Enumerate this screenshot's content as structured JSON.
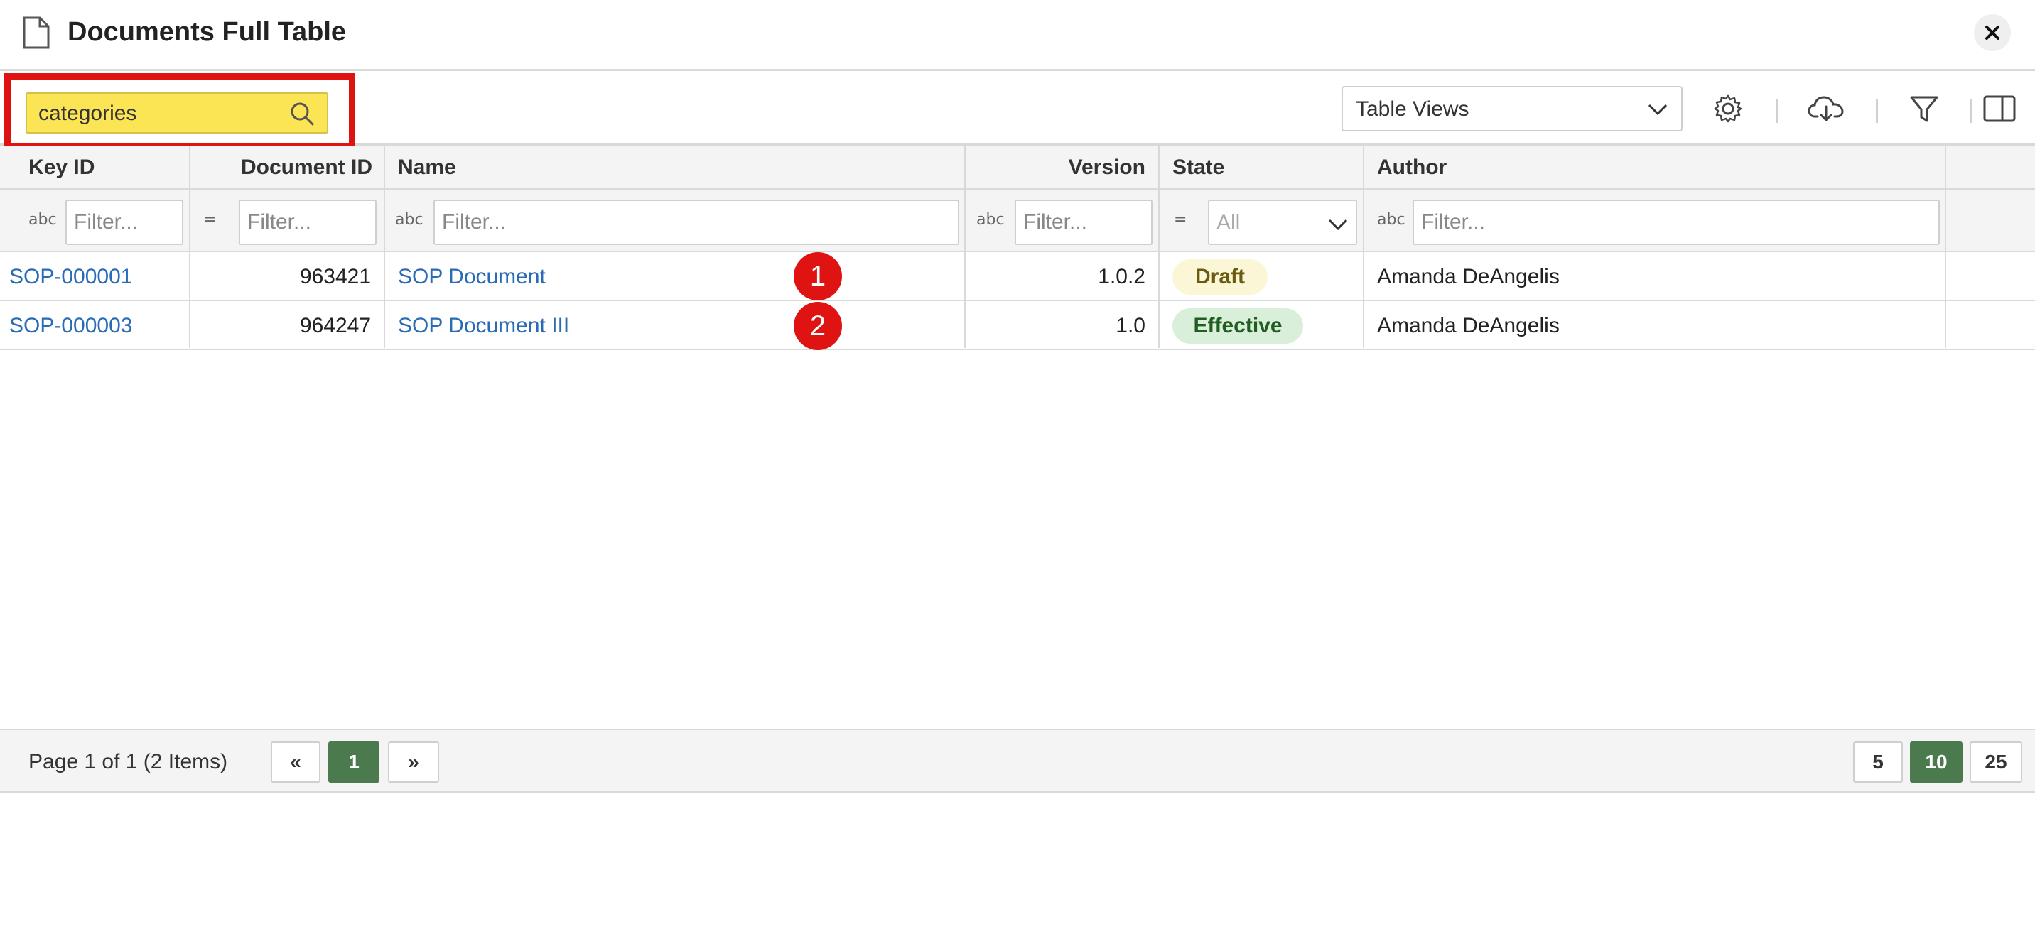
{
  "header": {
    "title": "Documents Full Table"
  },
  "toolbar": {
    "search_value": "categories",
    "table_views_label": "Table Views"
  },
  "columns": [
    "Key ID",
    "Document ID",
    "Name",
    "Version",
    "State",
    "Author"
  ],
  "filters": {
    "placeholder": "Filter...",
    "state_value": "All",
    "text_type_glyph": "abc",
    "equals_type_glyph": "="
  },
  "rows": [
    {
      "key_id": "SOP-000001",
      "document_id": "963421",
      "name": "SOP Document",
      "version": "1.0.2",
      "state": "Draft",
      "author": "Amanda DeAngelis",
      "marker": "1"
    },
    {
      "key_id": "SOP-000003",
      "document_id": "964247",
      "name": "SOP Document III",
      "version": "1.0",
      "state": "Effective",
      "author": "Amanda DeAngelis",
      "marker": "2"
    }
  ],
  "footer": {
    "page_info": "Page 1 of 1 (2 Items)",
    "prev": "«",
    "current_page": "1",
    "next": "»",
    "page_sizes": [
      "5",
      "10",
      "25"
    ],
    "active_page_size": "10"
  },
  "colors": {
    "highlight_border": "#e01313",
    "search_bg": "#fbe555",
    "link": "#2a6bb5",
    "active_button": "#4c7a4f"
  }
}
